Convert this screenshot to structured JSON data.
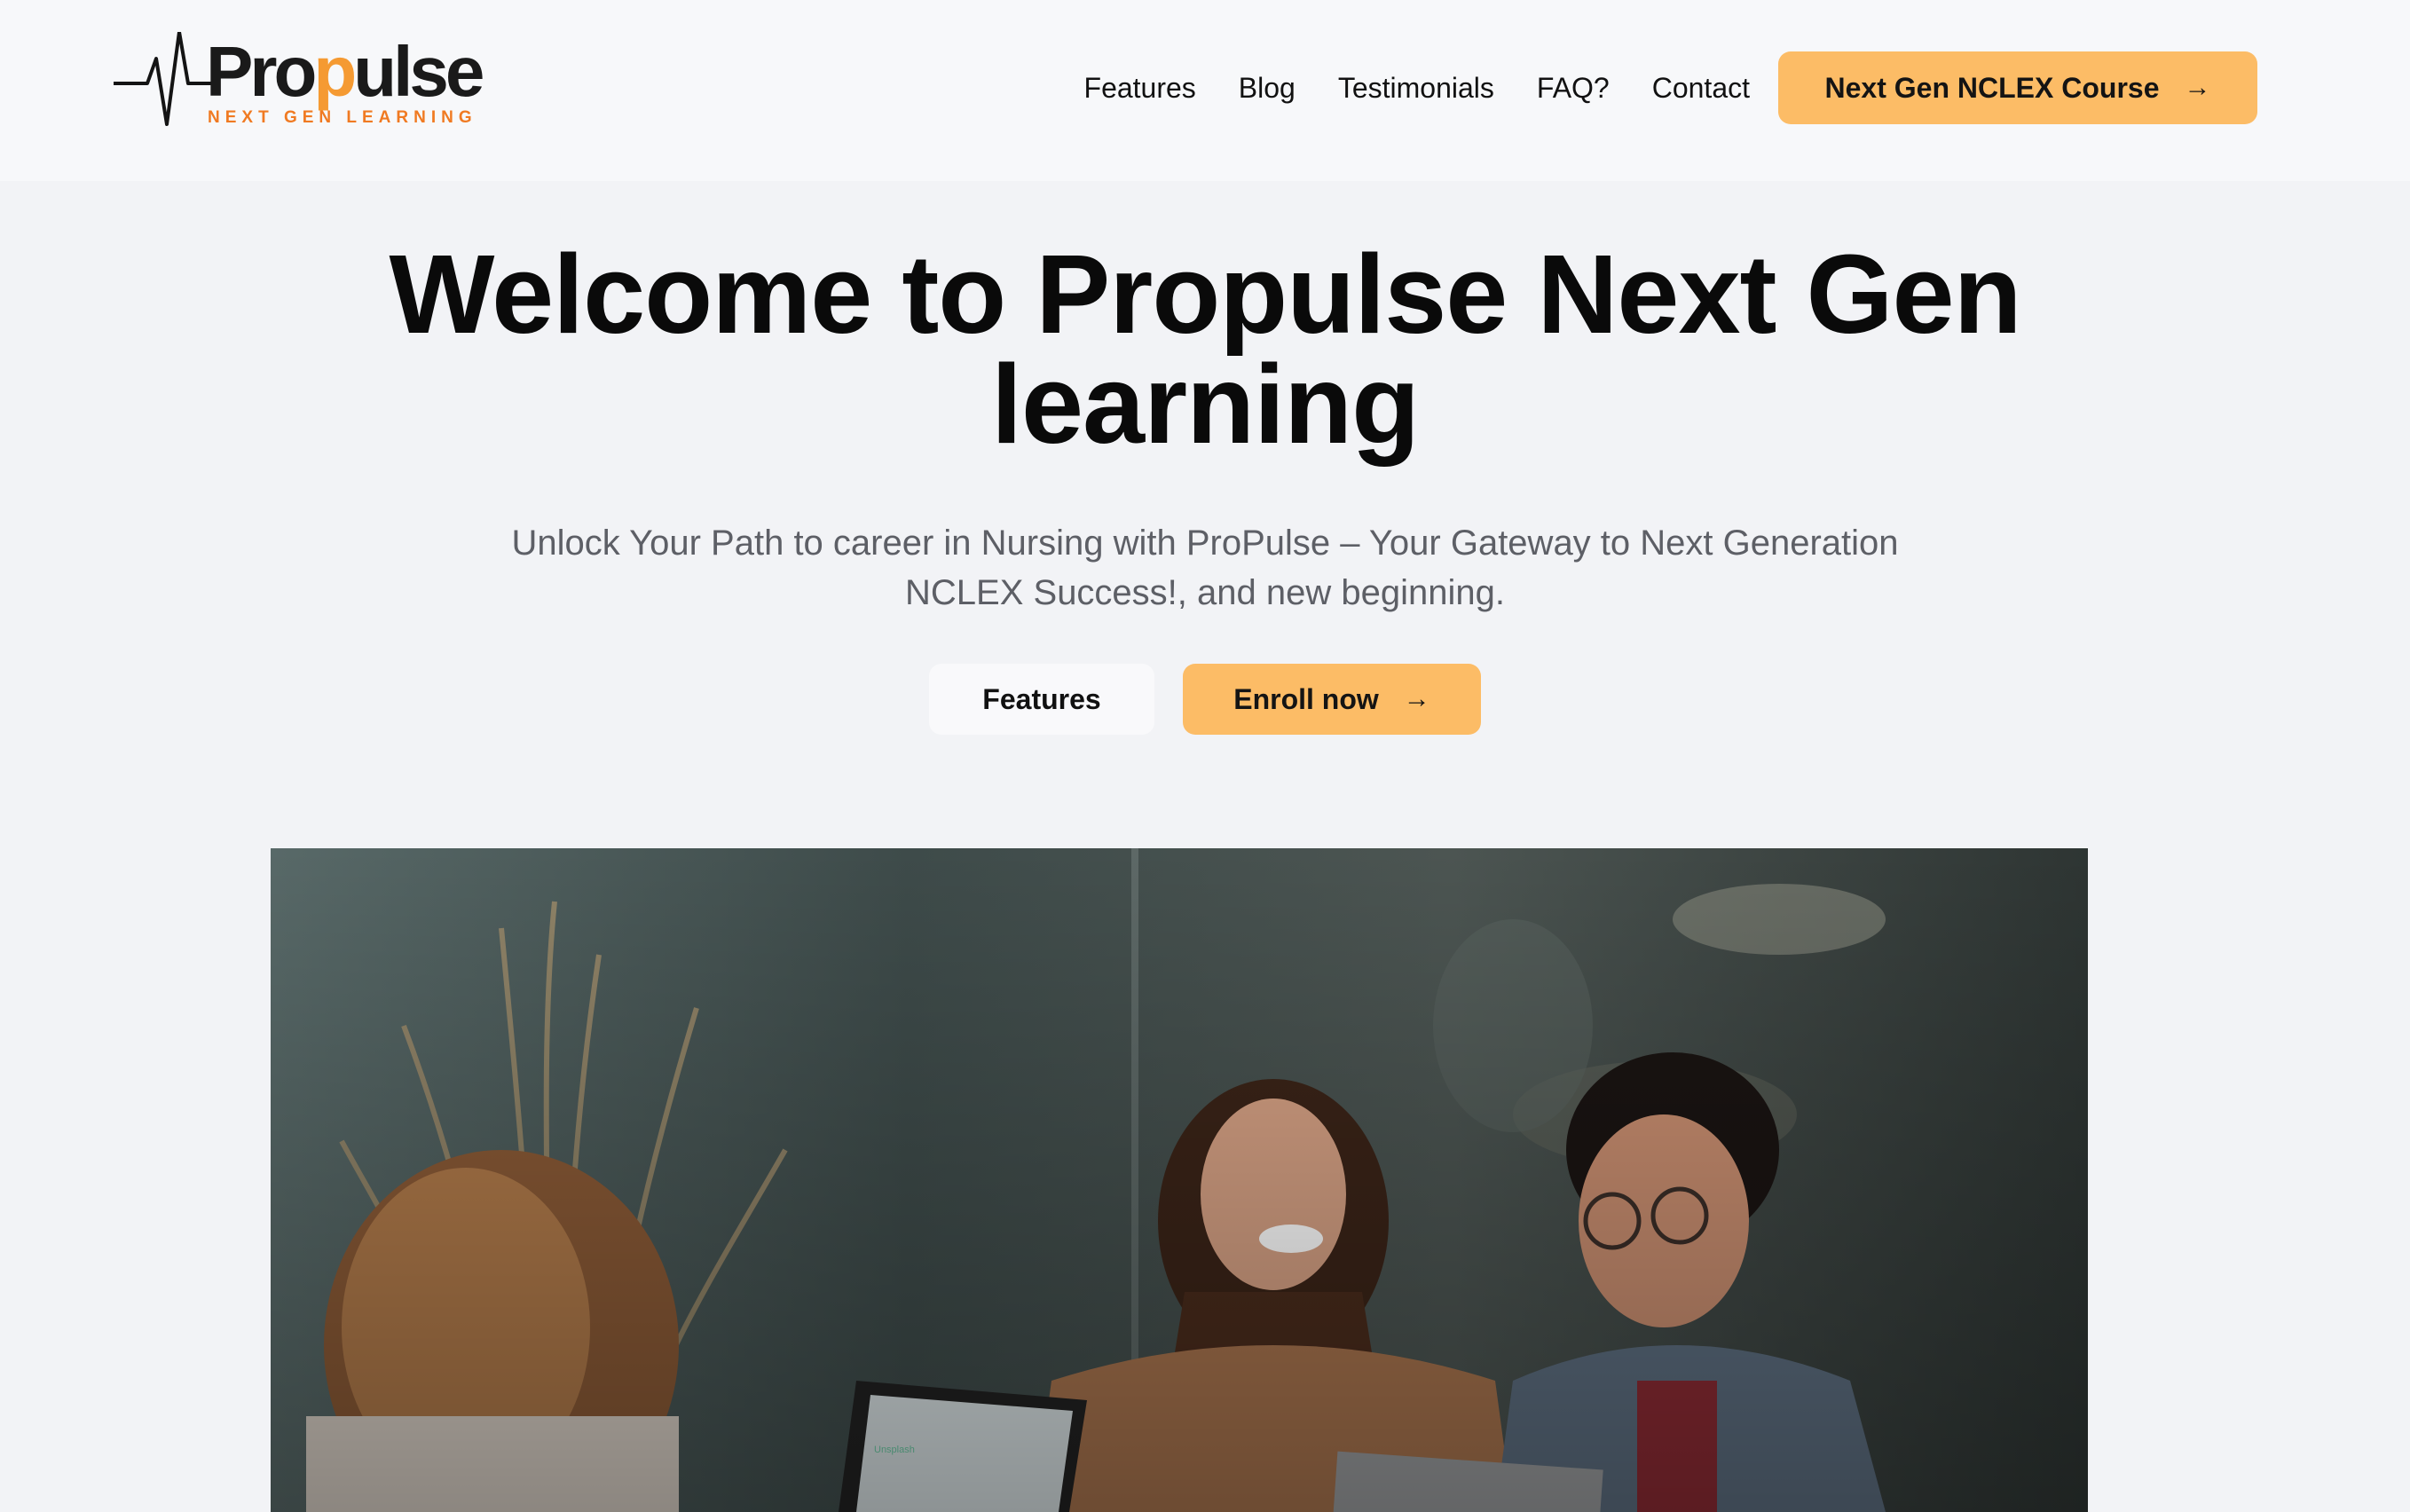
{
  "header": {
    "logo": {
      "word_prefix": "Pro",
      "word_mid": "p",
      "word_suffix": "ulse",
      "tagline": "NEXT GEN LEARNING"
    },
    "nav": [
      {
        "label": "Features"
      },
      {
        "label": "Blog"
      },
      {
        "label": "Testimonials"
      },
      {
        "label": "FAQ?"
      },
      {
        "label": "Contact"
      }
    ],
    "cta_label": "Next Gen NCLEX Course"
  },
  "hero": {
    "title": "Welcome to Propulse Next Gen learning",
    "subtitle": "Unlock Your Path to career in Nursing with ProPulse – Your Gateway to Next Generation NCLEX Success!, and new beginning.",
    "secondary_button": "Features",
    "primary_button": "Enroll now",
    "image_watermark": "Unsplash"
  },
  "colors": {
    "accent": "#fcbc66",
    "logo_orange": "#f59a32",
    "background": "#f2f3f6",
    "header_bg": "#f7f8fa"
  },
  "icons": [
    "heartbeat-logo-icon",
    "arrow-right-icon"
  ]
}
